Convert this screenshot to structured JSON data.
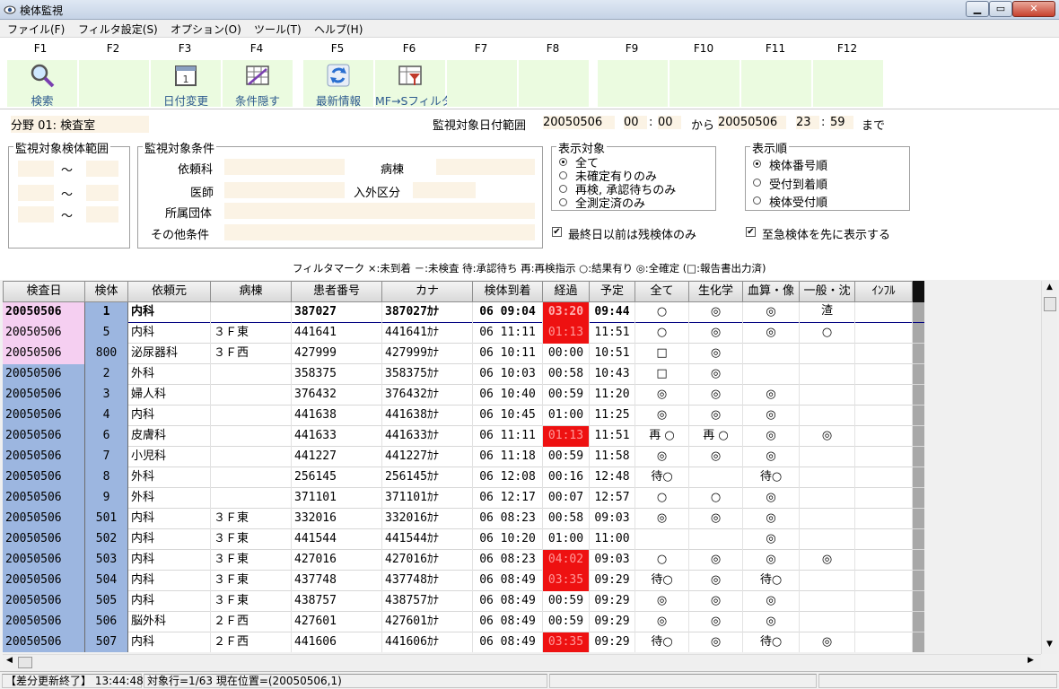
{
  "window": {
    "title": "検体監視",
    "min": "▁",
    "max": "▭",
    "close": "✕"
  },
  "menu": [
    "ファイル(F)",
    "フィルタ設定(S)",
    "オプション(O)",
    "ツール(T)",
    "ヘルプ(H)"
  ],
  "fkeys": {
    "labels": [
      "F1",
      "F2",
      "F3",
      "F4",
      "F5",
      "F6",
      "F7",
      "F8",
      "F9",
      "F10",
      "F11",
      "F12"
    ],
    "buttons": [
      "検索",
      "",
      "日付変更",
      "条件隠す",
      "最新情報",
      "MF→Sフィルタ",
      "",
      "",
      "",
      "",
      "",
      ""
    ]
  },
  "panel": {
    "field_label": "分野 01: 検査室",
    "date_range_label": "監視対象日付範囲",
    "from_date": "20050506",
    "from_hh": "00",
    "from_mm": "00",
    "colon": ":",
    "kara": "から",
    "to_date": "20050506",
    "to_hh": "23",
    "to_mm": "59",
    "made": "まで",
    "range_group": "監視対象検体範囲",
    "tilde": "～",
    "cond_group": "監視対象条件",
    "cond_dept": "依頼科",
    "cond_ward": "病棟",
    "cond_doctor": "医師",
    "cond_inout": "入外区分",
    "cond_org": "所属団体",
    "cond_other": "その他条件",
    "target_group": "表示対象",
    "target_opts": [
      "全て",
      "未確定有りのみ",
      "再検, 承認待ちのみ",
      "全測定済のみ"
    ],
    "order_group": "表示順",
    "order_opts": [
      "検体番号順",
      "受付到着順",
      "検体受付順"
    ],
    "chk_last": "最終日以前は残検体のみ",
    "chk_urgent": "至急検体を先に表示する",
    "check_mark": "✔",
    "filter_legend": "フィルタマーク ×:未到着 －:未検査 待:承認待ち 再:再検指示 ○:結果有り ◎:全確定 (□:報告書出力済)"
  },
  "grid": {
    "headers": [
      "検査日",
      "検体",
      "依頼元",
      "病棟",
      "患者番号",
      "カナ",
      "検体到着",
      "経過",
      "予定",
      "全て",
      "生化学",
      "血算・像",
      "一般・沈渣",
      "ｲﾝﾌﾙ"
    ],
    "rows": [
      [
        "20050506",
        "1",
        "内科",
        "",
        "387027",
        "387027ｶﾅ",
        "06 09:04",
        "03:20",
        "09:44",
        "○",
        "◎",
        "◎",
        "",
        "",
        1
      ],
      [
        "20050506",
        "5",
        "内科",
        "３Ｆ東",
        "441641",
        "441641ｶﾅ",
        "06 11:11",
        "01:13",
        "11:51",
        "○",
        "◎",
        "◎",
        "○",
        "",
        1
      ],
      [
        "20050506",
        "800",
        "泌尿器科",
        "３Ｆ西",
        "427999",
        "427999ｶﾅ",
        "06 10:11",
        "00:00",
        "10:51",
        "□",
        "◎",
        "",
        "",
        "",
        0
      ],
      [
        "20050506",
        "2",
        "外科",
        "",
        "358375",
        "358375ｶﾅ",
        "06 10:03",
        "00:58",
        "10:43",
        "□",
        "◎",
        "",
        "",
        "",
        0
      ],
      [
        "20050506",
        "3",
        "婦人科",
        "",
        "376432",
        "376432ｶﾅ",
        "06 10:40",
        "00:59",
        "11:20",
        "◎",
        "◎",
        "◎",
        "",
        "",
        0
      ],
      [
        "20050506",
        "4",
        "内科",
        "",
        "441638",
        "441638ｶﾅ",
        "06 10:45",
        "01:00",
        "11:25",
        "◎",
        "◎",
        "◎",
        "",
        "",
        0
      ],
      [
        "20050506",
        "6",
        "皮膚科",
        "",
        "441633",
        "441633ｶﾅ",
        "06 11:11",
        "01:13",
        "11:51",
        "再 ○",
        "再 ○",
        "◎",
        "◎",
        "",
        1
      ],
      [
        "20050506",
        "7",
        "小児科",
        "",
        "441227",
        "441227ｶﾅ",
        "06 11:18",
        "00:59",
        "11:58",
        "◎",
        "◎",
        "◎",
        "",
        "",
        0
      ],
      [
        "20050506",
        "8",
        "外科",
        "",
        "256145",
        "256145ｶﾅ",
        "06 12:08",
        "00:16",
        "12:48",
        "待○",
        "",
        "待○",
        "",
        "",
        0
      ],
      [
        "20050506",
        "9",
        "外科",
        "",
        "371101",
        "371101ｶﾅ",
        "06 12:17",
        "00:07",
        "12:57",
        "○",
        "○",
        "◎",
        "",
        "",
        0
      ],
      [
        "20050506",
        "501",
        "内科",
        "３Ｆ東",
        "332016",
        "332016ｶﾅ",
        "06 08:23",
        "00:58",
        "09:03",
        "◎",
        "◎",
        "◎",
        "",
        "",
        0
      ],
      [
        "20050506",
        "502",
        "内科",
        "３Ｆ東",
        "441544",
        "441544ｶﾅ",
        "06 10:20",
        "01:00",
        "11:00",
        "",
        "",
        "◎",
        "",
        "",
        0
      ],
      [
        "20050506",
        "503",
        "内科",
        "３Ｆ東",
        "427016",
        "427016ｶﾅ",
        "06 08:23",
        "04:02",
        "09:03",
        "○",
        "◎",
        "◎",
        "◎",
        "",
        1
      ],
      [
        "20050506",
        "504",
        "内科",
        "３Ｆ東",
        "437748",
        "437748ｶﾅ",
        "06 08:49",
        "03:35",
        "09:29",
        "待○",
        "◎",
        "待○",
        "",
        "",
        1
      ],
      [
        "20050506",
        "505",
        "内科",
        "３Ｆ東",
        "438757",
        "438757ｶﾅ",
        "06 08:49",
        "00:59",
        "09:29",
        "◎",
        "◎",
        "◎",
        "",
        "",
        0
      ],
      [
        "20050506",
        "506",
        "脳外科",
        "２Ｆ西",
        "427601",
        "427601ｶﾅ",
        "06 08:49",
        "00:59",
        "09:29",
        "◎",
        "◎",
        "◎",
        "",
        "",
        0
      ],
      [
        "20050506",
        "507",
        "内科",
        "２Ｆ西",
        "441606",
        "441606ｶﾅ",
        "06 08:49",
        "03:35",
        "09:29",
        "待○",
        "◎",
        "待○",
        "◎",
        "",
        1
      ]
    ]
  },
  "status": {
    "left": "【差分更新終了】 13:44:48",
    "middle": "対象行=1/63 現在位置=(20050506,1)"
  }
}
